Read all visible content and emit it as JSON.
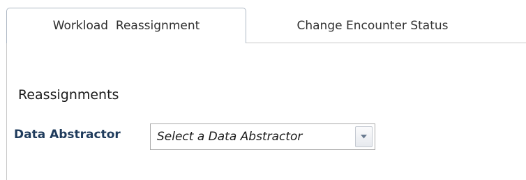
{
  "tabs": [
    {
      "label": "Workload  Reassignment",
      "active": true
    },
    {
      "label": "Change Encounter Status",
      "active": false
    }
  ],
  "section": {
    "title": "Reassignments"
  },
  "form": {
    "data_abstractor_label": "Data Abstractor",
    "data_abstractor_value": "Select a Data Abstractor",
    "dropdown_icon": "chevron-down-icon"
  },
  "colors": {
    "label_text": "#1f3b5c",
    "tab_border": "#aeb8c4",
    "dropdown_arrow": "#6a7b90"
  }
}
